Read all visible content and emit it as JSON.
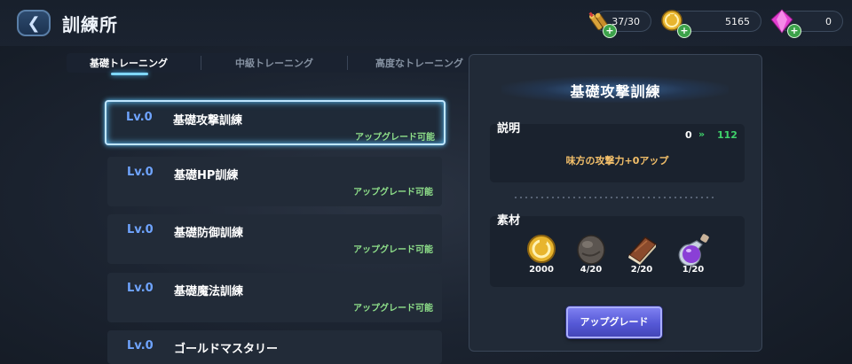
{
  "header": {
    "title": "訓練所",
    "back_icon": "chevron-left-icon",
    "resources": [
      {
        "icon": "ammo-icon",
        "value": "37/30"
      },
      {
        "icon": "gold-coin-icon",
        "value": "5165"
      },
      {
        "icon": "gem-icon",
        "value": "0"
      }
    ],
    "plus_label": "+"
  },
  "tabs": [
    {
      "label": "基礎トレーニング",
      "active": true
    },
    {
      "label": "中級トレーニング",
      "active": false
    },
    {
      "label": "高度なトレーニング",
      "active": false
    }
  ],
  "training_list": [
    {
      "level": "Lv.0",
      "name": "基礎攻撃訓練",
      "status": "アップグレード可能",
      "selected": true
    },
    {
      "level": "Lv.0",
      "name": "基礎HP訓練",
      "status": "アップグレード可能",
      "selected": false
    },
    {
      "level": "Lv.0",
      "name": "基礎防御訓練",
      "status": "アップグレード可能",
      "selected": false
    },
    {
      "level": "Lv.0",
      "name": "基礎魔法訓練",
      "status": "アップグレード可能",
      "selected": false
    },
    {
      "level": "Lv.0",
      "name": "ゴールドマスタリー",
      "status": "",
      "selected": false
    }
  ],
  "detail": {
    "title": "基礎攻撃訓練",
    "description_label": "説明",
    "current_value": "0",
    "arrow": "»",
    "next_value": "112",
    "description": "味方の攻撃力+0アップ",
    "materials_label": "素材",
    "materials": [
      {
        "icon": "gold-coin-icon",
        "count": "2000"
      },
      {
        "icon": "stone-icon",
        "count": "4/20"
      },
      {
        "icon": "book-icon",
        "count": "2/20"
      },
      {
        "icon": "potion-icon",
        "count": "1/20"
      }
    ],
    "upgrade_button": "アップグレード"
  },
  "colors": {
    "accent_blue": "#6fa4ff",
    "status_green": "#8fe08a",
    "desc_orange": "#f4c06a",
    "button_purple": "#5558d6"
  }
}
